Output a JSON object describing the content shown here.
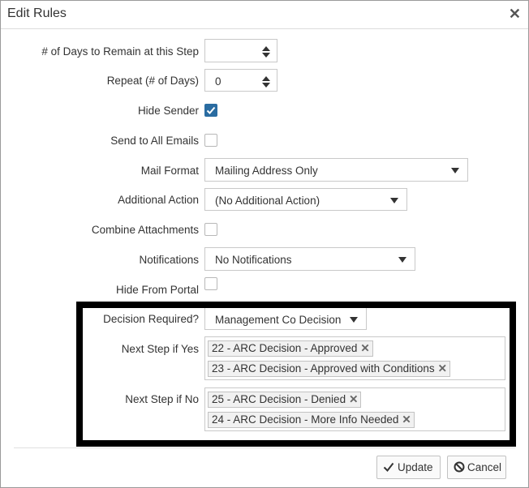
{
  "dialog": {
    "title": "Edit Rules"
  },
  "fields": {
    "days_label": "# of Days to Remain at this Step",
    "days_value": "",
    "repeat_label": "Repeat (# of Days)",
    "repeat_value": "0",
    "hide_sender_label": "Hide Sender",
    "hide_sender_checked": true,
    "send_all_label": "Send to All Emails",
    "send_all_checked": false,
    "mail_format_label": "Mail Format",
    "mail_format_value": "Mailing Address Only",
    "additional_action_label": "Additional Action",
    "additional_action_value": "(No Additional Action)",
    "combine_label": "Combine Attachments",
    "combine_checked": false,
    "notifications_label": "Notifications",
    "notifications_value": "No Notifications",
    "hide_portal_label": "Hide From Portal",
    "hide_portal_checked": false,
    "decision_label": "Decision Required?",
    "decision_value": "Management Co Decision",
    "next_yes_label": "Next Step if Yes",
    "next_yes_tags": [
      "22 - ARC Decision - Approved",
      "23 - ARC Decision - Approved with Conditions"
    ],
    "next_no_label": "Next Step if No",
    "next_no_tags": [
      "25 - ARC Decision - Denied",
      "24 - ARC Decision - More Info Needed"
    ]
  },
  "buttons": {
    "update": "Update",
    "cancel": "Cancel"
  },
  "icons": {
    "close": "close-icon",
    "check": "check-icon",
    "cancel": "ban-icon",
    "spinner": "spinner-arrows-icon",
    "caret": "caret-down-icon"
  },
  "colors": {
    "checkbox_checked": "#2a6ca1",
    "highlight_border": "#000000"
  }
}
